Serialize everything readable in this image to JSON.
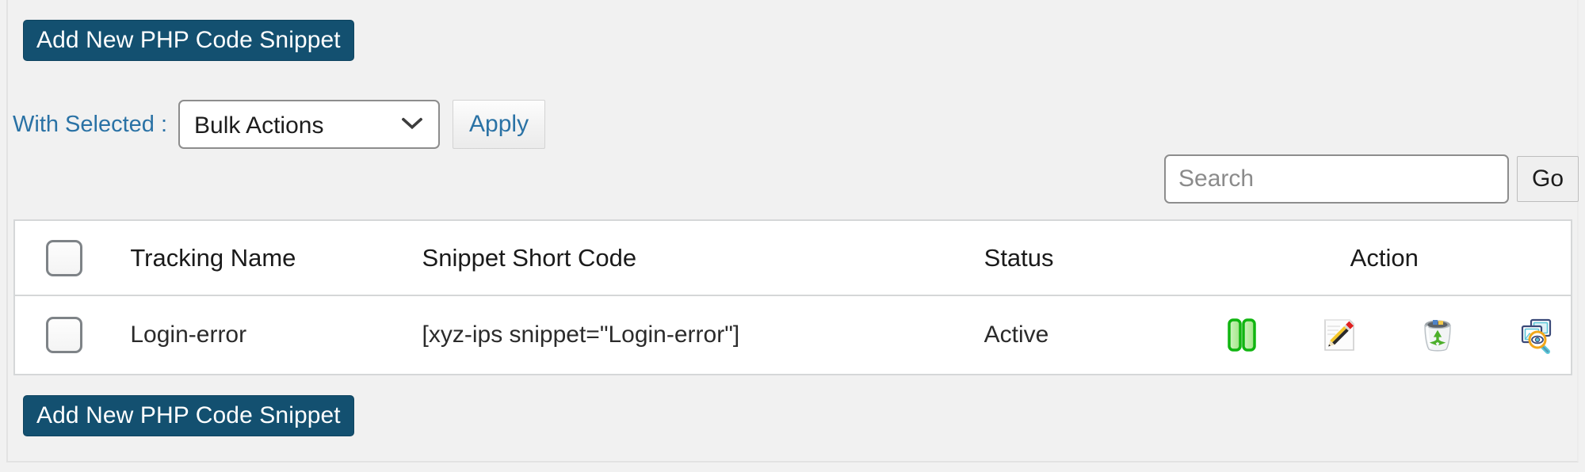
{
  "colors": {
    "page_bg": "#f1f1f1",
    "primary_button_bg": "#135070",
    "primary_button_text": "#ffffff",
    "link_blue": "#2a72a5",
    "table_border": "#d5d7d8",
    "status_active_text": "#2b2b2b",
    "pause_icon_green": "#1db91d"
  },
  "buttons": {
    "add_new_top": "Add New PHP Code Snippet",
    "add_new_bottom": "Add New PHP Code Snippet",
    "apply": "Apply",
    "go": "Go"
  },
  "bulk": {
    "label": "With Selected :",
    "selected_option": "Bulk Actions",
    "options": [
      "Bulk Actions"
    ]
  },
  "search": {
    "placeholder": "Search",
    "value": ""
  },
  "table": {
    "columns": [
      {
        "key": "select",
        "label": ""
      },
      {
        "key": "name",
        "label": "Tracking Name"
      },
      {
        "key": "code",
        "label": "Snippet Short Code"
      },
      {
        "key": "status",
        "label": "Status"
      },
      {
        "key": "action",
        "label": "Action"
      }
    ],
    "rows": [
      {
        "name": "Login-error",
        "code": "[xyz-ips snippet=\"Login-error\"]",
        "status": "Active",
        "actions": [
          "pause-icon",
          "edit-icon",
          "trash-icon",
          "preview-icon"
        ]
      }
    ]
  }
}
